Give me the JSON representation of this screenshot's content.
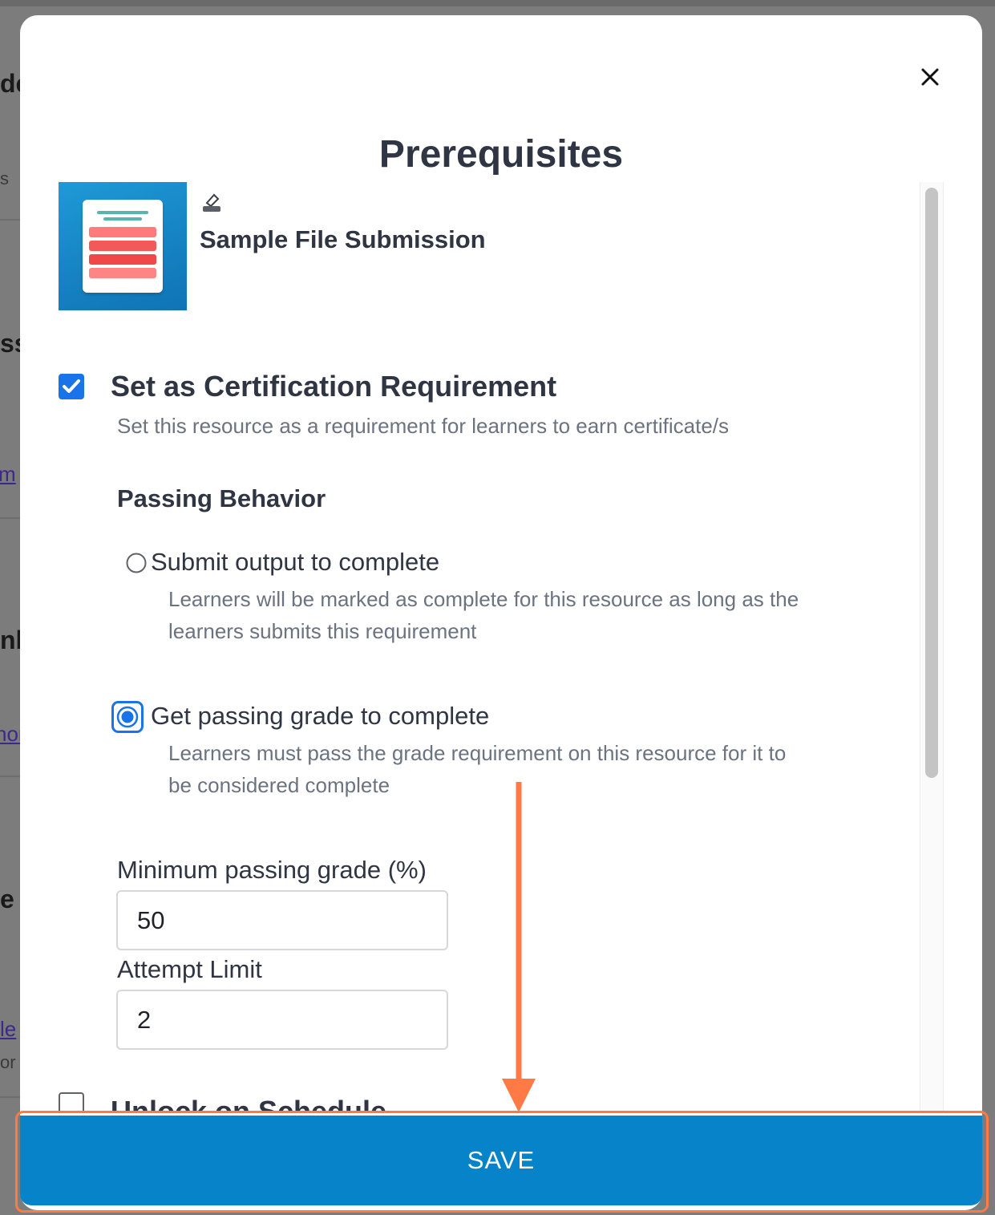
{
  "background": {
    "fragments": [
      {
        "text": "de",
        "style": "bold"
      },
      {
        "text": "s",
        "style": "light"
      },
      {
        "text": "ss",
        "style": "bold"
      },
      {
        "text": "m",
        "style": "link"
      },
      {
        "text": "nb",
        "style": "bold"
      },
      {
        "text": "nor",
        "style": "link"
      },
      {
        "text": "e",
        "style": "bold"
      },
      {
        "text": "le",
        "style": "link"
      },
      {
        "text": "or",
        "style": "light"
      }
    ]
  },
  "modal": {
    "title": "Prerequisites",
    "close_icon": "close-icon",
    "resource": {
      "thumbnail_icon": "document-icon",
      "edit_icon": "edit-icon",
      "title": "Sample File Submission"
    },
    "certification": {
      "checked": true,
      "title": "Set as Certification Requirement",
      "description": "Set this resource as a requirement for learners to earn certificate/s"
    },
    "passing_behavior": {
      "title": "Passing Behavior",
      "options": [
        {
          "label": "Submit output to complete",
          "description_line1": "Learners will be marked as complete for this resource as long as the",
          "description_line2": "learners submits this requirement",
          "selected": false
        },
        {
          "label": "Get passing grade to complete",
          "description_line1": "Learners must pass the grade requirement on this resource for it to",
          "description_line2": "be considered complete",
          "selected": true
        }
      ]
    },
    "grade_fields": {
      "min_grade_label": "Minimum passing grade (%)",
      "min_grade_value": "50",
      "attempt_label": "Attempt Limit",
      "attempt_value": "2"
    },
    "schedule": {
      "checked": false,
      "title": "Unlock on Schedule"
    },
    "save_label": "SAVE"
  },
  "colors": {
    "accent": "#0784c9",
    "checkbox": "#1a73e8",
    "annotation": "#ff7a45"
  }
}
